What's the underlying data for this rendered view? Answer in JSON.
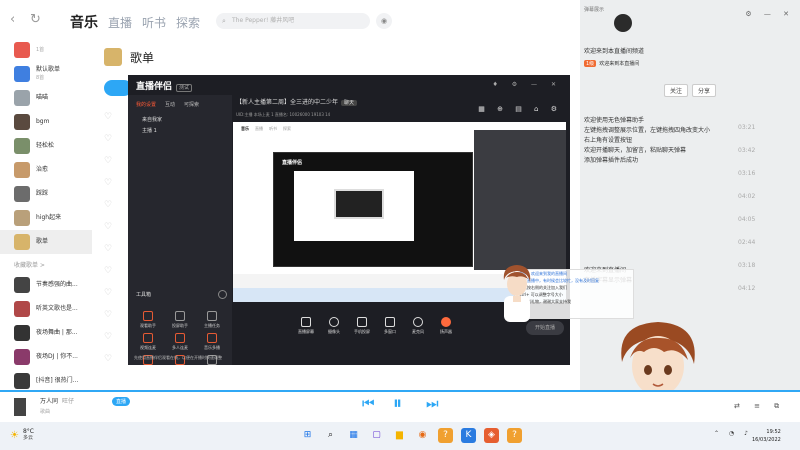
{
  "topbar": {
    "tabs": [
      "音乐",
      "直播",
      "听书",
      "探索"
    ],
    "search_placeholder": "The Pepper! 藤井风吧"
  },
  "sidebar": {
    "items": [
      {
        "l1": "",
        "l2": "1首",
        "color": "#e85a4f"
      },
      {
        "l1": "默认歌单",
        "l2": "8首",
        "color": "#3f7fe0"
      },
      {
        "l1": "喵喵",
        "l2": "",
        "color": "#9aa3aa"
      },
      {
        "l1": "bgm",
        "l2": "",
        "color": "#5a4a3f"
      },
      {
        "l1": "轻松松",
        "l2": "",
        "color": "#7a8f6a"
      },
      {
        "l1": "治愈",
        "l2": "",
        "color": "#c79a6a"
      },
      {
        "l1": "踩踩",
        "l2": "",
        "color": "#6c6c6c"
      },
      {
        "l1": "high起来",
        "l2": "",
        "color": "#b9a07a"
      },
      {
        "l1": "歌单",
        "l2": "",
        "color": "#d7b46a",
        "selected": true
      }
    ],
    "section": "收藏歌单 >",
    "fav_items": [
      {
        "l1": "节奏感强的曲...",
        "color": "#444"
      },
      {
        "l1": "听英文歌也是...",
        "color": "#b04848"
      },
      {
        "l1": "夜场舞曲 | 那...",
        "color": "#333"
      },
      {
        "l1": "夜场DJ | 你不...",
        "color": "#8a3a6a"
      },
      {
        "l1": "[抖音] 很热门...",
        "color": "#3a3a3a"
      }
    ]
  },
  "playlist": {
    "title": "歌单"
  },
  "assistant": {
    "brand": "直播伴侣",
    "version": "测试",
    "tabs": [
      "我的设置",
      "互动",
      "可探索"
    ],
    "source_lines": [
      "来自我家",
      "主播 1"
    ],
    "tools_label": "工具箱",
    "tools": [
      {
        "label": "观看助手",
        "accent": true
      },
      {
        "label": "投屏助手",
        "accent": false
      },
      {
        "label": "主播任务",
        "accent": false
      },
      {
        "label": "视频连麦",
        "accent": true
      },
      {
        "label": "多人连麦",
        "accent": true
      },
      {
        "label": "音乐多播",
        "accent": true
      },
      {
        "label": "优惠券",
        "accent": true
      },
      {
        "label": "道具管理",
        "accent": true
      },
      {
        "label": "弹幕库",
        "accent": false
      }
    ],
    "notice": "先使用直播伴侣观看在线，以便在开播时快速调整",
    "room_title": "【新人主播第二周】全三进的中二少年",
    "room_tag": "聊天",
    "stats": "UID:主播    本场上麦 1    直播名:    10026000    19103    14",
    "controls": [
      {
        "label": "直播屏幕",
        "shape": "sq"
      },
      {
        "label": "摄像头",
        "shape": "ci"
      },
      {
        "label": "手机投屏",
        "shape": "sq"
      },
      {
        "label": "多窗口",
        "shape": "sq"
      },
      {
        "label": "麦克风",
        "shape": "ci"
      },
      {
        "label": "扬声器",
        "shape": "org"
      }
    ],
    "live_button": "开始直播",
    "preview_tabs": [
      "音乐",
      "直播",
      "听书",
      "探索"
    ],
    "preview_logo": "直播伴侣"
  },
  "right_panel": {
    "name": "弹幕展示",
    "header": "欢迎来到本直播间频道",
    "fan_badge": "1级",
    "fan_text": "欢迎来到本直播间",
    "buttons": [
      "关注",
      "分享"
    ],
    "messages": [
      "欢迎使用无色弹幕助手",
      "左键拖拽调整展示位置，左键拖拽四角改变大小",
      "右上角有设置按钮",
      "欢迎开播聊天，加留言，粘贴聊天弹幕",
      "添加弹幕插件后成功"
    ],
    "messages2": [
      "欢迎来到直播间",
      "直播字幕显示弹幕"
    ]
  },
  "durations": [
    "03:21",
    "03:42",
    "03:16",
    "04:02",
    "04:05",
    "02:44",
    "03:18",
    "04:12"
  ],
  "overlay": {
    "lines": [
      "你好，欢迎来到我的直播间",
      "我在直播中，有时候会比较忙，没有及时回复",
      "可以按右侧的关注加入我们",
      "Ctrl+ 可以调整字号大小",
      "欢迎刷礼物，谢谢大家支持我"
    ]
  },
  "player": {
    "title": "万人同",
    "artist": "旺仔",
    "sub": "歌曲",
    "pill": "直播"
  },
  "taskbar": {
    "weather_temp": "8°C",
    "weather_desc": "多云",
    "time": "19:52",
    "date": "16/03/2022",
    "apps": [
      {
        "glyph": "⊞",
        "color": "#1a73e8",
        "bg": "transparent"
      },
      {
        "glyph": "⌕",
        "color": "#222",
        "bg": "transparent"
      },
      {
        "glyph": "▦",
        "color": "#1a73e8",
        "bg": "transparent"
      },
      {
        "glyph": "▢",
        "color": "#6a3fd4",
        "bg": "transparent"
      },
      {
        "glyph": "▆",
        "color": "#f4b400",
        "bg": "transparent"
      },
      {
        "glyph": "◉",
        "color": "#e66a14",
        "bg": "transparent"
      },
      {
        "glyph": "?",
        "color": "#fff",
        "bg": "#f0a030"
      },
      {
        "glyph": "K",
        "color": "#fff",
        "bg": "#2a7be0"
      },
      {
        "glyph": "◈",
        "color": "#fff",
        "bg": "#e65e30"
      },
      {
        "glyph": "?",
        "color": "#fff",
        "bg": "#f0a030"
      }
    ]
  }
}
